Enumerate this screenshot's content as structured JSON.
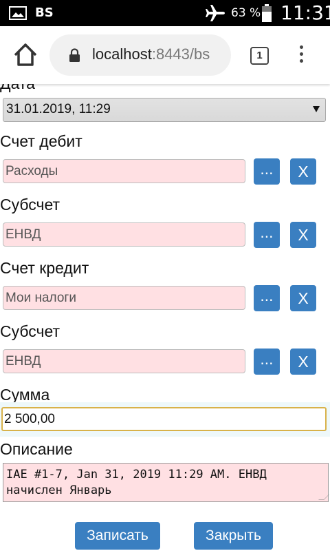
{
  "status_bar": {
    "carrier": "BS",
    "battery_percent": "63 %",
    "time": "11:31",
    "icons": [
      "gallery-icon",
      "airplane-mode-icon",
      "battery-icon"
    ]
  },
  "browser": {
    "url_host": "localhost",
    "url_rest": ":8443/bs",
    "tab_count": "1",
    "icons": [
      "home-icon",
      "lock-icon",
      "tabs-icon",
      "menu-icon"
    ]
  },
  "form": {
    "date_label": "Дата",
    "date_value": "31.01.2019, 11:29",
    "debit_account_label": "Счет дебит",
    "debit_account_value": "Расходы",
    "debit_subaccount_label": "Субсчет",
    "debit_subaccount_value": "ЕНВД",
    "credit_account_label": "Счет кредит",
    "credit_account_value": "Мои налоги",
    "credit_subaccount_label": "Субсчет",
    "credit_subaccount_value": "ЕНВД",
    "pick_label": "...",
    "clear_label": "X",
    "amount_label": "Сумма",
    "amount_value": "2 500,00",
    "description_label": "Описание",
    "description_lines": [
      "IAE #1-7, Jan 31, 2019 11:29 AM. ЕНВД",
      "начислен Январь"
    ],
    "save_label": "Записать",
    "close_label": "Закрыть"
  },
  "colors": {
    "button_blue": "#3a7fc1",
    "field_pink": "#ffe0e3",
    "focus_border": "#d8b24a"
  }
}
